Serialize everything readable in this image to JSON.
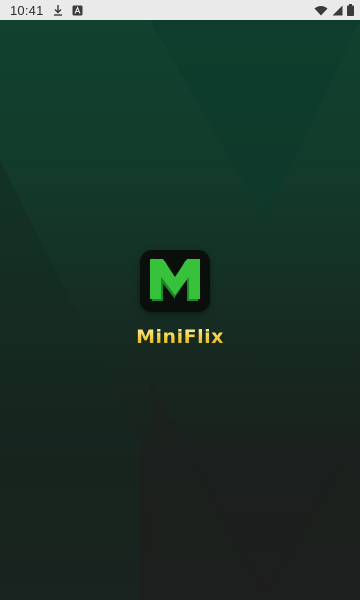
{
  "status_bar": {
    "time": "10:41",
    "left_icons": [
      "download-icon",
      "translate-a-icon"
    ],
    "right_icons": [
      "wifi-icon",
      "cellular-signal-icon",
      "battery-icon"
    ]
  },
  "splash": {
    "logo_letter": "M",
    "app_name": "MiniFlix"
  },
  "colors": {
    "status_bar_bg": "#e9eae9",
    "background_top": "#0f4330",
    "background_bottom": "#1e1e1e",
    "logo_bg": "#0a0f0c",
    "logo_green_light": "#38c23c",
    "logo_green_dark": "#1d8a28",
    "app_name_gold": "#f1cc3d"
  }
}
